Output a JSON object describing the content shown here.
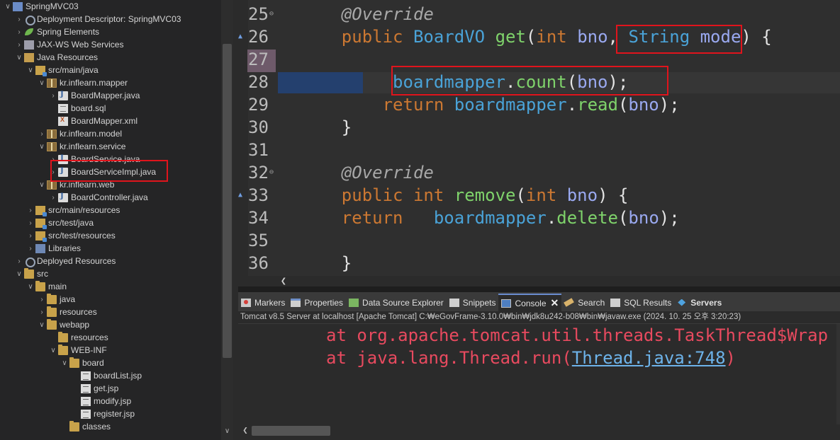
{
  "explorer": {
    "items": [
      {
        "label": "SpringMVC03",
        "icon": "project-icon"
      },
      {
        "label": "Deployment Descriptor: SpringMVC03",
        "icon": "descriptor-icon"
      },
      {
        "label": "Spring Elements",
        "icon": "spring-leaf-icon"
      },
      {
        "label": "JAX-WS Web Services",
        "icon": "webservice-icon"
      },
      {
        "label": "Java Resources",
        "icon": "java-resources-icon"
      },
      {
        "label": "src/main/java",
        "icon": "source-folder-icon"
      },
      {
        "label": "kr.inflearn.mapper",
        "icon": "package-icon"
      },
      {
        "label": "BoardMapper.java",
        "icon": "java-file-icon"
      },
      {
        "label": "board.sql",
        "icon": "sql-file-icon"
      },
      {
        "label": "BoardMapper.xml",
        "icon": "xml-file-icon"
      },
      {
        "label": "kr.inflearn.model",
        "icon": "package-icon"
      },
      {
        "label": "kr.inflearn.service",
        "icon": "package-icon"
      },
      {
        "label": "BoardService.java",
        "icon": "java-file-icon"
      },
      {
        "label": "BoardServiceImpl.java",
        "icon": "java-file-icon"
      },
      {
        "label": "kr.inflearn.web",
        "icon": "package-icon"
      },
      {
        "label": "BoardController.java",
        "icon": "java-file-icon"
      },
      {
        "label": "src/main/resources",
        "icon": "source-folder-icon"
      },
      {
        "label": "src/test/java",
        "icon": "source-folder-icon"
      },
      {
        "label": "src/test/resources",
        "icon": "source-folder-icon"
      },
      {
        "label": "Libraries",
        "icon": "libraries-icon"
      },
      {
        "label": "Deployed Resources",
        "icon": "deployed-resources-icon"
      },
      {
        "label": "src",
        "icon": "folder-icon"
      },
      {
        "label": "main",
        "icon": "folder-icon"
      },
      {
        "label": "java",
        "icon": "folder-icon"
      },
      {
        "label": "resources",
        "icon": "folder-icon"
      },
      {
        "label": "webapp",
        "icon": "folder-icon"
      },
      {
        "label": "resources",
        "icon": "folder-icon"
      },
      {
        "label": "WEB-INF",
        "icon": "folder-icon"
      },
      {
        "label": "board",
        "icon": "folder-icon"
      },
      {
        "label": "boardList.jsp",
        "icon": "jsp-file-icon"
      },
      {
        "label": "get.jsp",
        "icon": "jsp-file-icon"
      },
      {
        "label": "modify.jsp",
        "icon": "jsp-file-icon"
      },
      {
        "label": "register.jsp",
        "icon": "jsp-file-icon"
      },
      {
        "label": "classes",
        "icon": "folder-icon"
      }
    ]
  },
  "editor": {
    "lines": [
      {
        "num": "25",
        "tokens": [
          {
            "t": "    ",
            "c": "plain"
          },
          {
            "t": "@Override",
            "c": "ann"
          }
        ]
      },
      {
        "num": "26",
        "tokens": [
          {
            "t": "    ",
            "c": "plain"
          },
          {
            "t": "public",
            "c": "kw"
          },
          {
            "t": " ",
            "c": "plain"
          },
          {
            "t": "BoardVO",
            "c": "type"
          },
          {
            "t": " ",
            "c": "plain"
          },
          {
            "t": "get",
            "c": "method"
          },
          {
            "t": "(",
            "c": "plain"
          },
          {
            "t": "int",
            "c": "kw"
          },
          {
            "t": " ",
            "c": "plain"
          },
          {
            "t": "bno",
            "c": "var"
          },
          {
            "t": ", ",
            "c": "plain"
          },
          {
            "t": "String",
            "c": "type"
          },
          {
            "t": " ",
            "c": "plain"
          },
          {
            "t": "mode",
            "c": "var"
          },
          {
            "t": ") {",
            "c": "plain"
          }
        ]
      },
      {
        "num": "27",
        "tokens": []
      },
      {
        "num": "28",
        "tokens": [
          {
            "t": "         ",
            "c": "plain"
          },
          {
            "t": "boardmapper",
            "c": "type"
          },
          {
            "t": ".",
            "c": "plain"
          },
          {
            "t": "count",
            "c": "method"
          },
          {
            "t": "(",
            "c": "plain"
          },
          {
            "t": "bno",
            "c": "var"
          },
          {
            "t": ");",
            "c": "plain"
          }
        ]
      },
      {
        "num": "29",
        "tokens": [
          {
            "t": "        ",
            "c": "plain"
          },
          {
            "t": "return",
            "c": "kw"
          },
          {
            "t": " ",
            "c": "plain"
          },
          {
            "t": "boardmapper",
            "c": "type"
          },
          {
            "t": ".",
            "c": "plain"
          },
          {
            "t": "read",
            "c": "method"
          },
          {
            "t": "(",
            "c": "plain"
          },
          {
            "t": "bno",
            "c": "var"
          },
          {
            "t": ");",
            "c": "plain"
          }
        ]
      },
      {
        "num": "30",
        "tokens": [
          {
            "t": "    }",
            "c": "plain"
          }
        ]
      },
      {
        "num": "31",
        "tokens": []
      },
      {
        "num": "32",
        "tokens": [
          {
            "t": "    ",
            "c": "plain"
          },
          {
            "t": "@Override",
            "c": "ann"
          }
        ]
      },
      {
        "num": "33",
        "tokens": [
          {
            "t": "    ",
            "c": "plain"
          },
          {
            "t": "public",
            "c": "kw"
          },
          {
            "t": " ",
            "c": "plain"
          },
          {
            "t": "int",
            "c": "kw"
          },
          {
            "t": " ",
            "c": "plain"
          },
          {
            "t": "remove",
            "c": "method"
          },
          {
            "t": "(",
            "c": "plain"
          },
          {
            "t": "int",
            "c": "kw"
          },
          {
            "t": " ",
            "c": "plain"
          },
          {
            "t": "bno",
            "c": "var"
          },
          {
            "t": ") {",
            "c": "plain"
          }
        ]
      },
      {
        "num": "34",
        "tokens": [
          {
            "t": "    ",
            "c": "plain"
          },
          {
            "t": "return",
            "c": "kw"
          },
          {
            "t": "   ",
            "c": "plain"
          },
          {
            "t": "boardmapper",
            "c": "type"
          },
          {
            "t": ".",
            "c": "plain"
          },
          {
            "t": "delete",
            "c": "method"
          },
          {
            "t": "(",
            "c": "plain"
          },
          {
            "t": "bno",
            "c": "var"
          },
          {
            "t": ");",
            "c": "plain"
          }
        ]
      },
      {
        "num": "35",
        "tokens": []
      },
      {
        "num": "36",
        "tokens": [
          {
            "t": "    }",
            "c": "plain"
          }
        ]
      }
    ]
  },
  "panel": {
    "tabs": [
      {
        "label": "Markers",
        "icon": "markers-icon"
      },
      {
        "label": "Properties",
        "icon": "properties-icon"
      },
      {
        "label": "Data Source Explorer",
        "icon": "data-source-icon"
      },
      {
        "label": "Snippets",
        "icon": "snippets-icon"
      },
      {
        "label": "Console",
        "icon": "console-icon",
        "active": true
      },
      {
        "label": "Search",
        "icon": "search-icon"
      },
      {
        "label": "SQL Results",
        "icon": "sql-results-icon"
      },
      {
        "label": "Servers",
        "icon": "servers-icon",
        "bold": true
      }
    ],
    "console_header": "Tomcat v8.5 Server at localhost [Apache Tomcat] C:₩eGovFrame-3.10.0₩bin₩jdk8u242-b08₩bin₩javaw.exe  (2024. 10. 25 오후 3:20:23)",
    "console_lines": [
      {
        "prefix": "at org.apache.tomcat.util.threads.TaskThread$Wrap",
        "link": "",
        "suffix": ""
      },
      {
        "prefix": "at java.lang.Thread.run(",
        "link": "Thread.java:748",
        "suffix": ")"
      }
    ]
  },
  "colors": {
    "highlight_box": "#e0141c",
    "console_error": "#e84a5f"
  }
}
